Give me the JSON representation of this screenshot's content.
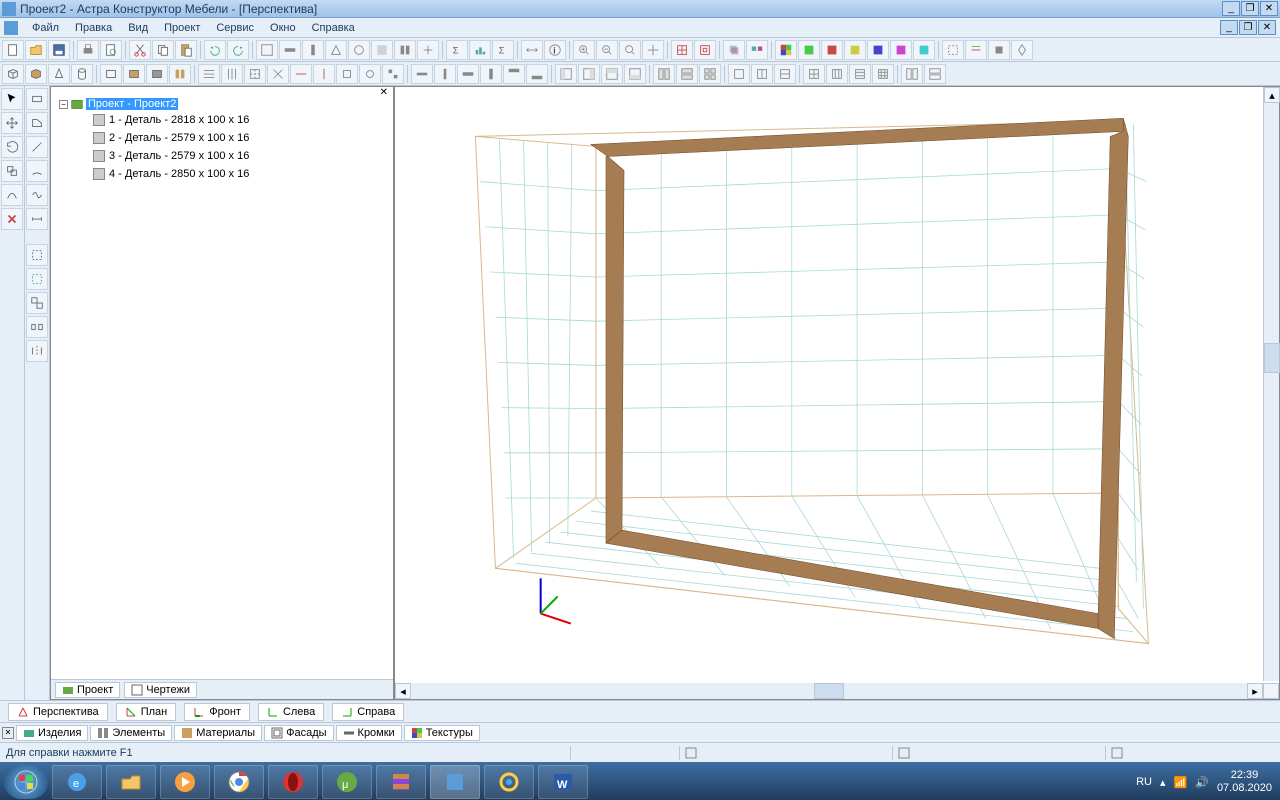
{
  "title": "Проект2 - Астра Конструктор Мебели - [Перспектива]",
  "menu": [
    "Файл",
    "Правка",
    "Вид",
    "Проект",
    "Сервис",
    "Окно",
    "Справка"
  ],
  "tree": {
    "root": "Проект - Проект2",
    "items": [
      "1 - Деталь - 2818 x 100 x 16",
      "2 - Деталь - 2579 x 100 x 16",
      "3 - Деталь - 2579 x 100 x 16",
      "4 - Деталь - 2850 x 100 x 16"
    ],
    "tabs": [
      "Проект",
      "Чертежи"
    ]
  },
  "viewport": {
    "title": "Перспектива",
    "tabs": [
      "Перспектива",
      "План",
      "Фронт",
      "Слева",
      "Справа"
    ]
  },
  "bottom_tabs": [
    "Изделия",
    "Элементы",
    "Материалы",
    "Фасады",
    "Кромки",
    "Текстуры"
  ],
  "status": "Для справки нажмите F1",
  "systray": {
    "lang": "RU",
    "time": "22:39",
    "date": "07.08.2020"
  }
}
